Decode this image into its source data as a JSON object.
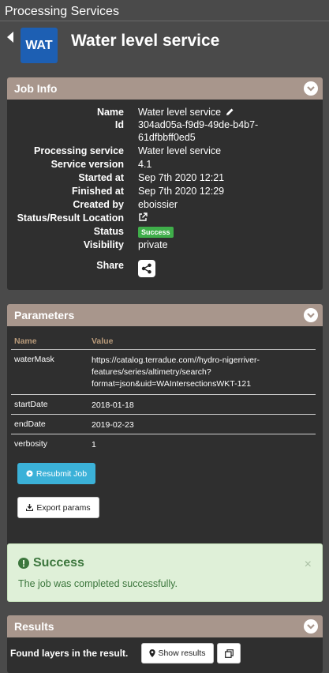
{
  "topbar": {
    "title": "Processing Services"
  },
  "header": {
    "badge": "WAT",
    "service_title": "Water level service"
  },
  "job_info": {
    "title": "Job Info",
    "rows": [
      {
        "key": "Name",
        "value": "Water level service"
      },
      {
        "key": "Id",
        "value": "304ad05a-f9d9-49de-b4b7-"
      },
      {
        "key": "",
        "value": "61dfbbff0ed5"
      },
      {
        "key": "Processing service",
        "value": "Water level service"
      },
      {
        "key": "Service version",
        "value": "4.1"
      },
      {
        "key": "Started at",
        "value": "Sep 7th 2020 12:21"
      },
      {
        "key": "Finished at",
        "value": "Sep 7th 2020 12:29"
      },
      {
        "key": "Created by",
        "value": "eboissier"
      },
      {
        "key": "Status/Result Location",
        "value": ""
      },
      {
        "key": "Status",
        "value": "Success"
      },
      {
        "key": "Visibility",
        "value": "private"
      },
      {
        "key": "Share",
        "value": ""
      }
    ]
  },
  "parameters": {
    "title": "Parameters",
    "headers": {
      "name": "Name",
      "value": "Value"
    },
    "rows": [
      {
        "name": "waterMask",
        "value_lines": [
          "https://catalog.terradue.com//hydro-nigerriver-",
          "features/series/altimetry/search?",
          "format=json&uid=WAIntersectionsWKT-121"
        ]
      },
      {
        "name": "startDate",
        "value_lines": [
          "2018-01-18"
        ]
      },
      {
        "name": "endDate",
        "value_lines": [
          "2019-02-23"
        ]
      },
      {
        "name": "verbosity",
        "value_lines": [
          "1"
        ]
      }
    ],
    "resubmit_label": "Resubmit Job",
    "export_label": "Export params"
  },
  "alert": {
    "title": "Success",
    "message": "The job was completed successfully.",
    "close": "×"
  },
  "results": {
    "title": "Results",
    "text": "Found layers in the result.",
    "show_label": "Show results"
  },
  "colors": {
    "background": "#4a4a4a",
    "panel": "#2f2f2f",
    "panel_header": "#a8968c",
    "badge": "#1d5fb3",
    "success": "#3fae4a",
    "resubmit": "#3bb1d8",
    "alert_bg": "#dff0d8",
    "alert_text": "#3c763d"
  }
}
